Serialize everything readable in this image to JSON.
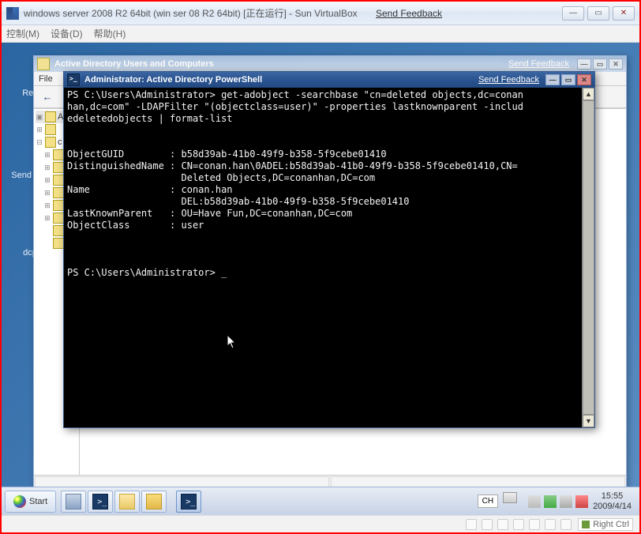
{
  "host": {
    "title": "windows server 2008 R2 64bit (win ser 08 R2 64bit) [正在运行] - Sun VirtualBox",
    "feedback": "Send Feedback",
    "menu": {
      "control": "控制(M)",
      "devices": "设备(D)",
      "help": "帮助(H)"
    },
    "capture": "Right Ctrl"
  },
  "desktop": {
    "recycle": "Rec",
    "sendf": "Send F",
    "dcp": "dcp"
  },
  "aduc": {
    "title": "Active Directory Users and Computers",
    "feedback": "Send Feedback",
    "menu": {
      "file": "File",
      "edit": "E"
    },
    "tree": {
      "root": "Activ"
    }
  },
  "psh": {
    "title": "Administrator: Active Directory PowerShell",
    "feedback": "Send Feedback",
    "prompt": "PS C:\\Users\\Administrator>",
    "cmd_l1": "PS C:\\Users\\Administrator> get-adobject -searchbase \"cn=deleted objects,dc=conan",
    "cmd_l2": "han,dc=com\" -LDAPFilter \"(objectclass=user)\" -properties lastknownparent -includ",
    "cmd_l3": "edeletedobjects | format-list",
    "out": {
      "ObjectGUID_k": "ObjectGUID       ",
      "ObjectGUID_v": "b58d39ab-41b0-49f9-b358-5f9cebe01410",
      "DistinguishedName_k": "DistinguishedName",
      "DistinguishedName_v1": "CN=conan.han\\0ADEL:b58d39ab-41b0-49f9-b358-5f9cebe01410,CN=",
      "DistinguishedName_v2": "Deleted Objects,DC=conanhan,DC=com",
      "Name_k": "Name             ",
      "Name_v1": "conan.han",
      "Name_v2": "DEL:b58d39ab-41b0-49f9-b358-5f9cebe01410",
      "LastKnownParent_k": "LastKnownParent  ",
      "LastKnownParent_v": "OU=Have Fun,DC=conanhan,DC=com",
      "ObjectClass_k": "ObjectClass      ",
      "ObjectClass_v": "user"
    }
  },
  "taskbar": {
    "start": "Start",
    "lang": "CH",
    "time": "15:55",
    "date": "2009/4/14"
  }
}
